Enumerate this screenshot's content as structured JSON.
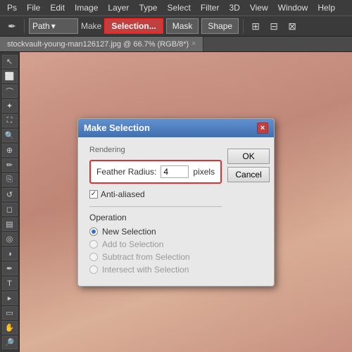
{
  "menubar": {
    "items": [
      "Ps",
      "File",
      "Edit",
      "Image",
      "Layer",
      "Type",
      "Select",
      "Filter",
      "3D",
      "View",
      "Window",
      "Help"
    ]
  },
  "toolbar": {
    "path_dropdown": "Path",
    "make_label": "Make",
    "selection_button": "Selection...",
    "mask_button": "Mask",
    "shape_button": "Shape"
  },
  "tab": {
    "filename": "stockvault-young-man126127.jpg @ 66.7% (RGB/8*)",
    "close": "×"
  },
  "dialog": {
    "title": "Make Selection",
    "close": "×",
    "rendering_label": "Rendering",
    "feather_label": "Feather Radius:",
    "feather_value": "4",
    "feather_unit": "pixels",
    "antialias_label": "Anti-aliased",
    "antialias_checked": true,
    "operation_label": "Operation",
    "operations": [
      {
        "label": "New Selection",
        "selected": true,
        "disabled": false
      },
      {
        "label": "Add to Selection",
        "selected": false,
        "disabled": true
      },
      {
        "label": "Subtract from Selection",
        "selected": false,
        "disabled": true
      },
      {
        "label": "Intersect with Selection",
        "selected": false,
        "disabled": true
      }
    ],
    "ok_label": "OK",
    "cancel_label": "Cancel"
  }
}
